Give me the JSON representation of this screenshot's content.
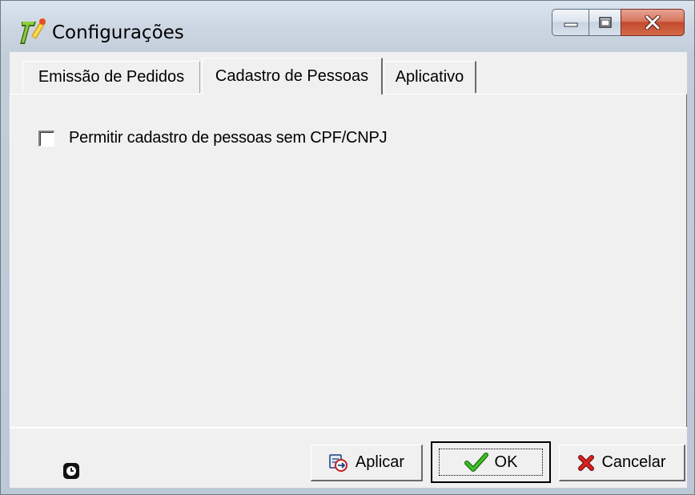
{
  "window": {
    "title": "Configurações",
    "minimize_icon": "minimize-icon",
    "maximize_icon": "maximize-icon",
    "close_icon": "close-icon"
  },
  "tabs": [
    {
      "label": "Emissão de Pedidos"
    },
    {
      "label": "Cadastro de Pessoas",
      "selected": true
    },
    {
      "label": "Aplicativo"
    }
  ],
  "page": {
    "checkbox": {
      "label": "Permitir cadastro de pessoas sem CPF/CNPJ",
      "checked": false
    }
  },
  "footer": {
    "clock_icon": "clock-icon",
    "apply_label": "Aplicar",
    "ok_label": "OK",
    "cancel_label": "Cancelar"
  },
  "colors": {
    "close_button": "#c34a2e",
    "check_green": "#2f9a1c",
    "cancel_red": "#c8201b"
  }
}
